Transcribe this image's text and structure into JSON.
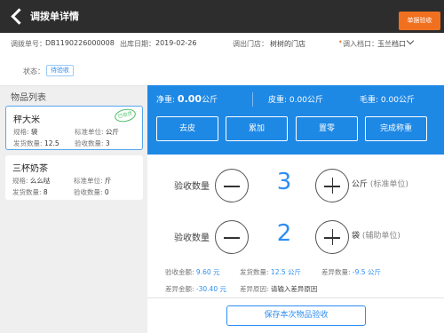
{
  "header": {
    "title": "调拨单详情",
    "receive_button": "单据验收",
    "back_icon": "back-arrow-icon"
  },
  "info": {
    "order_label": "调拨单号：",
    "order_no": "DB1190226000008",
    "date_label": "出库日期：",
    "date": "2019-02-26",
    "from_label": "调出门店：",
    "from_store": "树树的门店",
    "to_label": "调入档口：",
    "to_stall": "玉兰档口",
    "status_label": "状态：",
    "status": "待验收"
  },
  "product_list": {
    "title": "物品列表",
    "items": [
      {
        "name": "秤大米",
        "spec_label": "规格:",
        "spec": "袋",
        "std_unit_label": "标准单位:",
        "std_unit": "公斤",
        "ship_label": "发货数量:",
        "ship_qty": "12.5",
        "recv_label": "验收数量:",
        "recv_qty": "3",
        "stamp": "已收货"
      },
      {
        "name": "三杯奶茶",
        "spec_label": "规格:",
        "spec": "么么哒",
        "std_unit_label": "标准单位:",
        "std_unit": "斤",
        "ship_label": "发货数量:",
        "ship_qty": "8",
        "recv_label": "验收数量:",
        "recv_qty": "0"
      }
    ]
  },
  "weigh": {
    "net_label": "净重:",
    "net_value": "0.00",
    "net_unit": "公斤",
    "tare_label": "皮重:",
    "tare_value": "0.00公斤",
    "gross_label": "毛重:",
    "gross_value": "0.00公斤",
    "buttons": [
      "去皮",
      "累加",
      "置零",
      "完成称重"
    ]
  },
  "counters": [
    {
      "label": "验收数量",
      "value": "3",
      "unit": "公斤",
      "unit_note": "(标准单位)"
    },
    {
      "label": "验收数量",
      "value": "2",
      "unit": "袋",
      "unit_note": "(辅助单位)"
    }
  ],
  "summary": {
    "recv_amount_label": "验收金额:",
    "recv_amount": "9.60 元",
    "ship_qty_label": "发货数量:",
    "ship_qty": "12.5 公斤",
    "diff_qty_label": "差异数量:",
    "diff_qty": "-9.5 公斤",
    "diff_amount_label": "差异金额:",
    "diff_amount": "-30.40 元",
    "diff_reason_label": "差异原因:",
    "diff_reason_placeholder": "请输入差异原因"
  },
  "save_button": "保存本次物品验收",
  "colors": {
    "accent": "#1e88e5",
    "orange": "#f07020",
    "topbar": "#2d2d2d"
  }
}
